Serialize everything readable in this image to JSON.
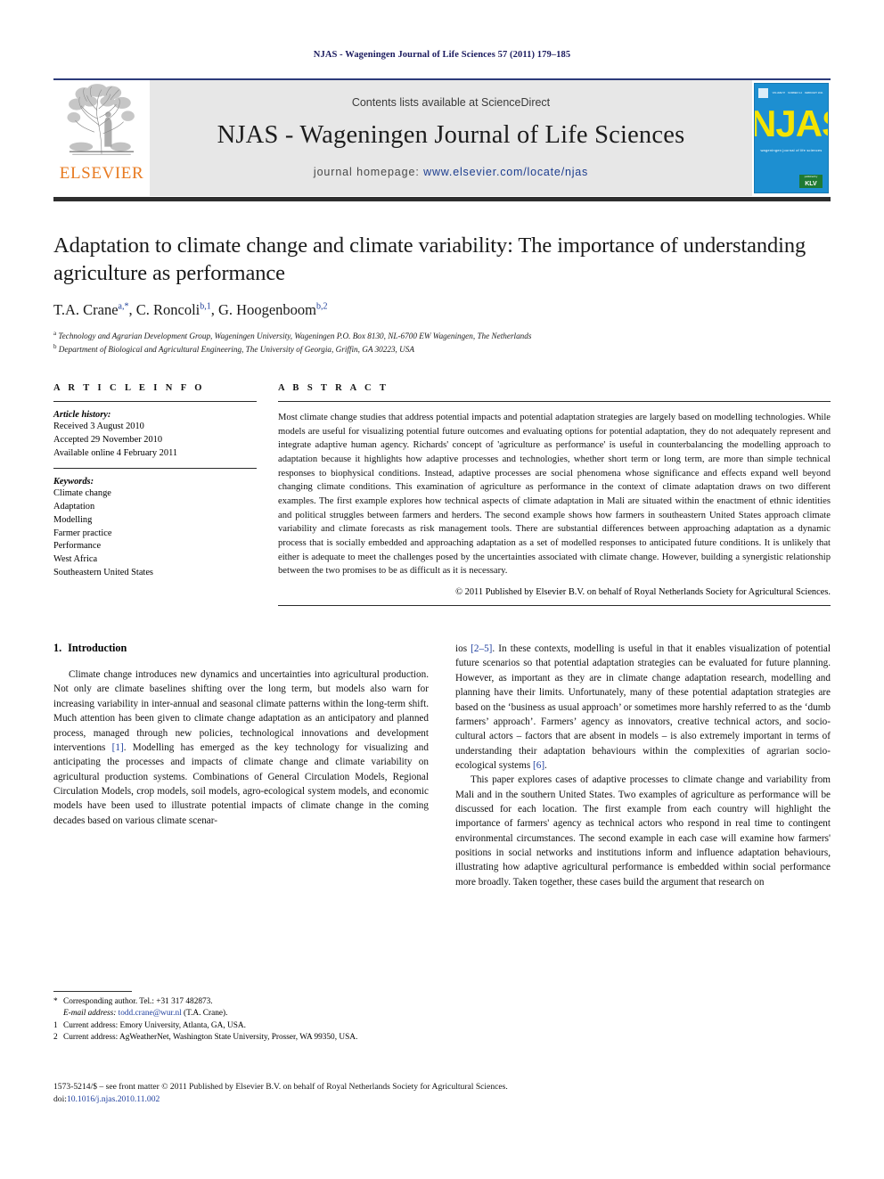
{
  "running_head": "NJAS - Wageningen Journal of Life Sciences 57 (2011) 179–185",
  "masthead": {
    "publisher_name": "ELSEVIER",
    "contents_line": "Contents lists available at ScienceDirect",
    "journal_title": "NJAS - Wageningen Journal of Life Sciences",
    "homepage_label": "journal homepage:",
    "homepage_url": "www.elsevier.com/locate/njas",
    "cover": {
      "title": "NJAS",
      "subtitle": "wageningen journal of life sciences",
      "society_badge": "KLV",
      "society_badge_top": "published by"
    }
  },
  "article": {
    "title": "Adaptation to climate change and climate variability: The importance of understanding agriculture as performance",
    "authors_plain": "T.A. Crane",
    "authors": [
      {
        "name": "T.A. Crane",
        "marks": "a,*"
      },
      {
        "name": "C. Roncoli",
        "marks": "b,1"
      },
      {
        "name": "G. Hoogenboom",
        "marks": "b,2"
      }
    ],
    "affiliations": [
      {
        "mark": "a",
        "text": "Technology and Agrarian Development Group, Wageningen University, Wageningen P.O. Box 8130, NL-6700 EW Wageningen, The Netherlands"
      },
      {
        "mark": "b",
        "text": "Department of Biological and Agricultural Engineering, The University of Georgia, Griffin, GA 30223, USA"
      }
    ]
  },
  "article_info": {
    "heading": "A R T I C L E  I N F O",
    "history_label": "Article history:",
    "history": [
      "Received 3 August 2010",
      "Accepted 29 November 2010",
      "Available online 4 February 2011"
    ],
    "keywords_label": "Keywords:",
    "keywords": [
      "Climate change",
      "Adaptation",
      "Modelling",
      "Farmer practice",
      "Performance",
      "West Africa",
      "Southeastern United States"
    ]
  },
  "abstract": {
    "heading": "A B S T R A C T",
    "text": "Most climate change studies that address potential impacts and potential adaptation strategies are largely based on modelling technologies. While models are useful for visualizing potential future outcomes and evaluating options for potential adaptation, they do not adequately represent and integrate adaptive human agency. Richards' concept of 'agriculture as performance' is useful in counterbalancing the modelling approach to adaptation because it highlights how adaptive processes and technologies, whether short term or long term, are more than simple technical responses to biophysical conditions. Instead, adaptive processes are social phenomena whose significance and effects expand well beyond changing climate conditions. This examination of agriculture as performance in the context of climate adaptation draws on two different examples. The first example explores how technical aspects of climate adaptation in Mali are situated within the enactment of ethnic identities and political struggles between farmers and herders. The second example shows how farmers in southeastern United States approach climate variability and climate forecasts as risk management tools. There are substantial differences between approaching adaptation as a dynamic process that is socially embedded and approaching adaptation as a set of modelled responses to anticipated future conditions. It is unlikely that either is adequate to meet the challenges posed by the uncertainties associated with climate change. However, building a synergistic relationship between the two promises to be as difficult as it is necessary.",
    "copyright": "© 2011 Published by Elsevier B.V. on behalf of Royal Netherlands Society for Agricultural Sciences."
  },
  "body": {
    "section_number": "1.",
    "section_title": "Introduction",
    "left_paragraph_1_a": "Climate change introduces new dynamics and uncertainties into agricultural production. Not only are climate baselines shifting over the long term, but models also warn for increasing variability in inter-annual and seasonal climate patterns within the long-term shift. Much attention has been given to climate change adaptation as an anticipatory and planned process, managed through new policies, technological innovations and development interventions ",
    "left_ref_1": "[1]",
    "left_paragraph_1_b": ". Modelling has emerged as the key technology for visualizing and anticipating the processes and impacts of climate change and climate variability on agricultural production systems. Combinations of General Circulation Models, Regional Circulation Models, crop models, soil models, agro-ecological system models, and economic models have been used to illustrate potential impacts of climate change in the coming decades based on various climate scenar-",
    "right_ref_1": "[2–5]",
    "right_paragraph_1": "ios . In these contexts, modelling is useful in that it enables visualization of potential future scenarios so that potential adaptation strategies can be evaluated for future planning. However, as important as they are in climate change adaptation research, modelling and planning have their limits. Unfortunately, many of these potential adaptation strategies are based on the 'business as usual approach' or sometimes more harshly referred to as the 'dumb farmers' approach'. Farmers' agency as innovators, creative technical actors, and socio-cultural actors – factors that are absent in models – is also extremely important in terms of understanding their adaptation behaviours within the complexities of agrarian socio-ecological systems ",
    "right_ref_2": "[6]",
    "right_paragraph_1_end": ".",
    "right_paragraph_2": "This paper explores cases of adaptive processes to climate change and variability from Mali and in the southern United States. Two examples of agriculture as performance will be discussed for each location. The first example from each country will highlight the importance of farmers' agency as technical actors who respond in real time to contingent environmental circumstances. The second example in each case will examine how farmers' positions in social networks and institutions inform and influence adaptation behaviours, illustrating how adaptive agricultural performance is embedded within social performance more broadly. Taken together, these cases build the argument that research on"
  },
  "footnotes": [
    {
      "mark": "*",
      "text": "Corresponding author. Tel.: +31 317 482873."
    },
    {
      "mark": "",
      "label": "E-mail address:",
      "link": "todd.crane@wur.nl",
      "text": " (T.A. Crane)."
    },
    {
      "mark": "1",
      "text": "Current address: Emory University, Atlanta, GA, USA."
    },
    {
      "mark": "2",
      "text": "Current address: AgWeatherNet, Washington State University, Prosser, WA 99350, USA."
    }
  ],
  "footer": {
    "issn_line": "1573-5214/$ – see front matter © 2011 Published by Elsevier B.V. on behalf of Royal Netherlands Society for Agricultural Sciences.",
    "doi_label": "doi:",
    "doi_value": "10.1016/j.njas.2010.11.002"
  },
  "colors": {
    "running_head": "#1a1a5e",
    "elsevier_orange": "#E87B22",
    "link_blue": "#1f3f9e",
    "banner_grey": "#e7e7e7",
    "cover_blue": "#1d8fd1",
    "cover_yellow": "#F5E400",
    "rule_dark": "#2e2e2e",
    "rule_blue": "#2c3b7a"
  }
}
